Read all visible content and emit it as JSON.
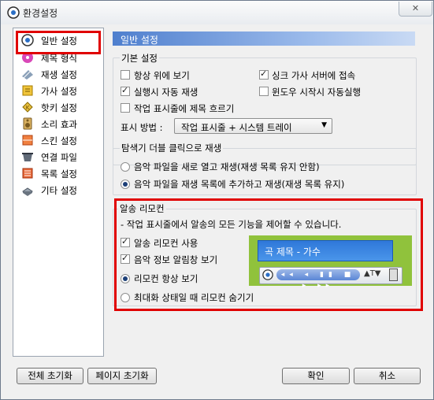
{
  "window": {
    "title": "환경설정",
    "close_symbol": "✕"
  },
  "nav": {
    "items": [
      {
        "label": "일반 설정",
        "icon": "general-settings-icon"
      },
      {
        "label": "제목 형식",
        "icon": "title-format-icon"
      },
      {
        "label": "재생 설정",
        "icon": "playback-settings-icon"
      },
      {
        "label": "가사 설정",
        "icon": "lyrics-settings-icon"
      },
      {
        "label": "핫키 설정",
        "icon": "hotkey-settings-icon"
      },
      {
        "label": "소리 효과",
        "icon": "sound-effect-icon"
      },
      {
        "label": "스킨 설정",
        "icon": "skin-settings-icon"
      },
      {
        "label": "연결 파일",
        "icon": "file-association-icon"
      },
      {
        "label": "목록 설정",
        "icon": "list-settings-icon"
      },
      {
        "label": "기타 설정",
        "icon": "other-settings-icon"
      }
    ],
    "selected_index": 0
  },
  "panel": {
    "header": "일반 설정",
    "basic": {
      "title": "기본 설정",
      "always_on_top": {
        "label": "항상 위에 보기",
        "checked": false
      },
      "sync_lyrics": {
        "label": "싱크 가사 서버에 접속",
        "checked": true
      },
      "autoplay": {
        "label": "실행시 자동 재생",
        "checked": true
      },
      "windows_startup": {
        "label": "윈도우 시작시 자동실행",
        "checked": false
      },
      "taskbar_scroll": {
        "label": "작업 표시줄에 제목 흐르기",
        "checked": false
      },
      "display_method_label": "표시 방법 :",
      "display_method_value": "작업 표시줄 + 시스템 트레이"
    },
    "explorer": {
      "title": "탐색기 더블 클릭으로 재생",
      "opt_new": {
        "label": "음악 파일을 새로 열고 재생(재생 목록 유지 안함)",
        "selected": false
      },
      "opt_add": {
        "label": "음악 파일을 재생 목록에 추가하고 재생(재생 목록 유지)",
        "selected": true
      }
    },
    "remote": {
      "title": "알송 리모컨",
      "description": "- 작업 표시줄에서 알송의 모든 기능을 제어할 수 있습니다.",
      "use_remote": {
        "label": "알송 리모컨 사용",
        "checked": true
      },
      "info_popup": {
        "label": "음악 정보 알림창 보기",
        "checked": true
      },
      "always_show": {
        "label": "리모컨 항상 보기",
        "selected": true
      },
      "hide_maximized": {
        "label": "최대화 상태일 때 리모컨 숨기기",
        "selected": false
      },
      "preview_song": "곡 제목 - 가수",
      "preview_controls": "◂◂ ◂ ▮▮ ■ ▸ ▸▸",
      "preview_extra": "▲T▼"
    }
  },
  "footer": {
    "reset_all": "전체 초기화",
    "reset_page": "페이지 초기화",
    "ok": "확인",
    "cancel": "취소"
  },
  "colors": {
    "accent_red": "#e00000",
    "header_blue": "#4f7fce",
    "preview_green": "#90c23c"
  }
}
